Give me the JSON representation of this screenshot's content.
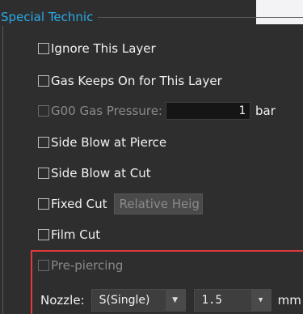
{
  "group": {
    "title": "Special Technic"
  },
  "options": {
    "ignore_layer": "Ignore This Layer",
    "gas_keeps_on": "Gas Keeps On for This Layer",
    "g00_gas_pressure": "G00 Gas Pressure:",
    "g00_gas_value": "1",
    "g00_gas_unit": "bar",
    "side_blow_pierce": "Side Blow at Pierce",
    "side_blow_cut": "Side Blow at Cut",
    "fixed_cut": "Fixed Cut",
    "relative_height_button": "Relative Heig",
    "film_cut": "Film Cut",
    "pre_piercing": "Pre-piercing"
  },
  "nozzle": {
    "label": "Nozzle:",
    "type_value": "S(Single)",
    "size_value": "1.5",
    "unit": "mm"
  },
  "colors": {
    "background": "#2e2e2e",
    "title_accent": "#2aa9e6",
    "highlight_box": "#e03a3a"
  }
}
